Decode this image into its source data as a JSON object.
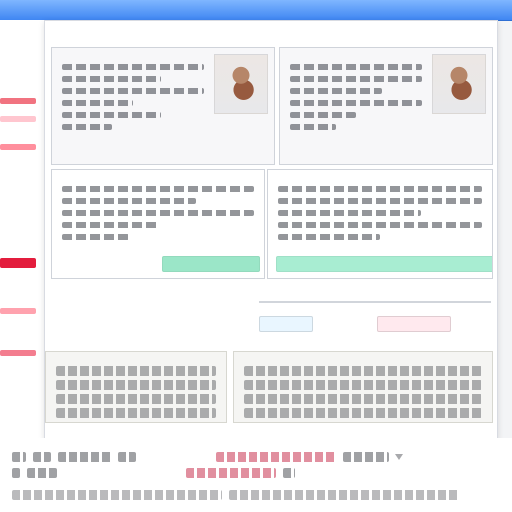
{
  "window": {
    "accent": "#3f86f2"
  },
  "canvas": {
    "panels": [
      {
        "title": "",
        "content_lines": 6,
        "has_photo": true
      },
      {
        "title": "",
        "content_lines": 6,
        "has_photo": true
      },
      {
        "title": "",
        "content_lines": 5,
        "has_photo": false,
        "cta": {
          "label": ""
        }
      },
      {
        "title": "",
        "content_lines": 5,
        "has_photo": false,
        "cta": {
          "label": ""
        }
      }
    ],
    "mid_actions": [
      {
        "label": ""
      },
      {
        "label": ""
      }
    ],
    "cards": [
      {
        "title": "",
        "lines": 4
      },
      {
        "title": "",
        "lines": 4
      }
    ]
  },
  "footer": {
    "row1": [
      {
        "text": ""
      },
      {
        "text": ""
      }
    ],
    "row2": [
      {
        "text": ""
      },
      {
        "text": ""
      }
    ],
    "row3": {
      "text": ""
    }
  },
  "icons": {
    "dropdown": "chevron-down-icon"
  },
  "colors": {
    "red": "#e31d3d",
    "green": "#9be6c8",
    "blue": "#0b61b9"
  }
}
